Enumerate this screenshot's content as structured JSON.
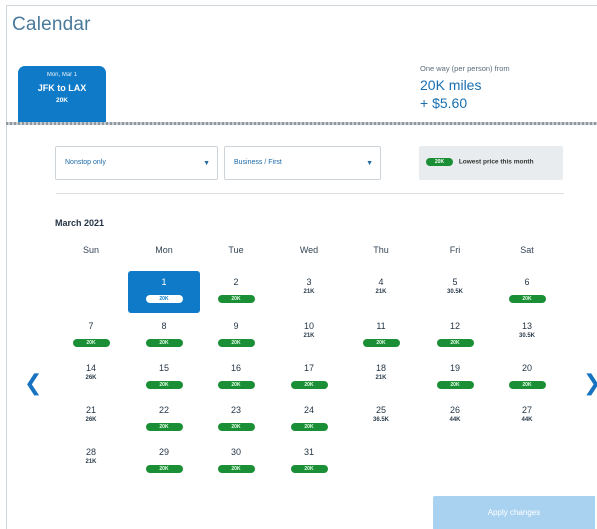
{
  "header": {
    "title": "Calendar"
  },
  "tab": {
    "date": "Mon, Mar 1",
    "route": "JFK to LAX",
    "miles": "20K"
  },
  "fare": {
    "label": "One way (per person) from",
    "miles": "20K miles",
    "tax": "+ $5.60"
  },
  "filters": {
    "stops": {
      "value": "Nonstop only"
    },
    "cabin": {
      "value": "Business / First"
    }
  },
  "legend": {
    "pill": "20K",
    "text": "Lowest price this month"
  },
  "calendar": {
    "month": "March 2021",
    "weekdays": [
      "Sun",
      "Mon",
      "Tue",
      "Wed",
      "Thu",
      "Fri",
      "Sat"
    ],
    "days": [
      {
        "day": "1",
        "price": "20K",
        "lowest": true,
        "selected": true
      },
      {
        "day": "2",
        "price": "20K",
        "lowest": true
      },
      {
        "day": "3",
        "price": "21K",
        "lowest": false
      },
      {
        "day": "4",
        "price": "21K",
        "lowest": false
      },
      {
        "day": "5",
        "price": "30.5K",
        "lowest": false
      },
      {
        "day": "6",
        "price": "20K",
        "lowest": true
      },
      {
        "day": "7",
        "price": "20K",
        "lowest": true
      },
      {
        "day": "8",
        "price": "20K",
        "lowest": true
      },
      {
        "day": "9",
        "price": "20K",
        "lowest": true
      },
      {
        "day": "10",
        "price": "21K",
        "lowest": false
      },
      {
        "day": "11",
        "price": "20K",
        "lowest": true
      },
      {
        "day": "12",
        "price": "20K",
        "lowest": true
      },
      {
        "day": "13",
        "price": "30.5K",
        "lowest": false
      },
      {
        "day": "14",
        "price": "26K",
        "lowest": false
      },
      {
        "day": "15",
        "price": "20K",
        "lowest": true
      },
      {
        "day": "16",
        "price": "20K",
        "lowest": true
      },
      {
        "day": "17",
        "price": "20K",
        "lowest": true
      },
      {
        "day": "18",
        "price": "21K",
        "lowest": false
      },
      {
        "day": "19",
        "price": "20K",
        "lowest": true
      },
      {
        "day": "20",
        "price": "20K",
        "lowest": true
      },
      {
        "day": "21",
        "price": "26K",
        "lowest": false
      },
      {
        "day": "22",
        "price": "20K",
        "lowest": true
      },
      {
        "day": "23",
        "price": "20K",
        "lowest": true
      },
      {
        "day": "24",
        "price": "20K",
        "lowest": true
      },
      {
        "day": "25",
        "price": "36.5K",
        "lowest": false
      },
      {
        "day": "26",
        "price": "44K",
        "lowest": false
      },
      {
        "day": "27",
        "price": "44K",
        "lowest": false
      },
      {
        "day": "28",
        "price": "21K",
        "lowest": false
      },
      {
        "day": "29",
        "price": "20K",
        "lowest": true
      },
      {
        "day": "30",
        "price": "20K",
        "lowest": true
      },
      {
        "day": "31",
        "price": "20K",
        "lowest": true
      }
    ]
  },
  "icons": {
    "prev": "chevron-left-icon",
    "next": "chevron-right-icon",
    "caret": "caret-down-icon"
  },
  "glyphs": {
    "prev": "❮",
    "next": "❯",
    "caret": "▼"
  },
  "colors": {
    "accent": "#0f7ac8",
    "lowest": "#1b8f36",
    "apply_disabled": "#a9d1f0"
  },
  "footer": {
    "apply_label": "Apply changes"
  }
}
